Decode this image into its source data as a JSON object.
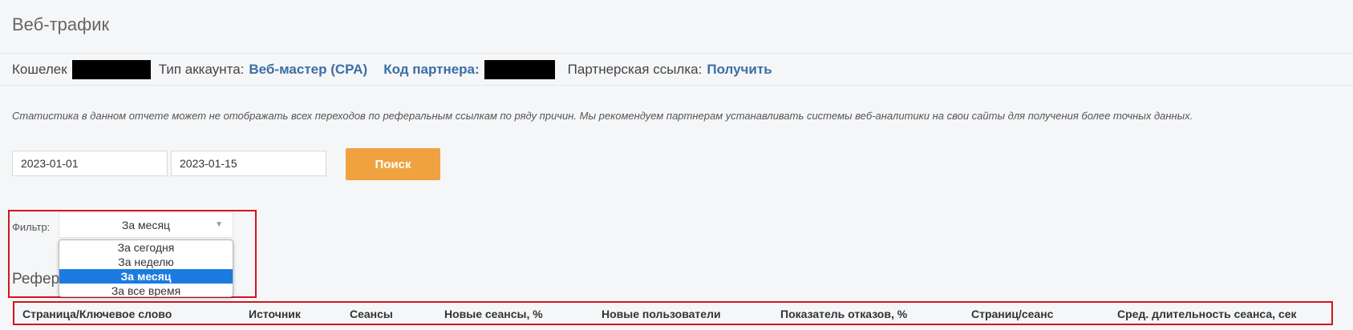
{
  "page": {
    "title": "Веб-трафик"
  },
  "account": {
    "wallet_label": "Кошелек",
    "type_label": "Тип аккаунта:",
    "type_value": "Веб-мастер (CPA)",
    "partner_code_label": "Код партнера:",
    "partner_link_label": "Партнерская ссылка:",
    "partner_link_action": "Получить"
  },
  "notice": "Статистика в данном отчете может не отображать всех переходов по реферальным ссылкам по ряду причин. Мы рекомендуем партнерам устанавливать системы веб-аналитики на свои сайты для получения более точных данных.",
  "dates": {
    "from": "2023-01-01",
    "to": "2023-01-15"
  },
  "search_button": "Поиск",
  "filter": {
    "label": "Фильтр:",
    "selected": "За месяц",
    "arrow": "▼",
    "options": [
      "За сегодня",
      "За неделю",
      "За месяц",
      "За все время"
    ],
    "selected_index": 2
  },
  "section_title": "Рефер",
  "table": {
    "columns": [
      "Страница/Ключевое слово",
      "Источник",
      "Сеансы",
      "Новые сеансы, %",
      "Новые пользователи",
      "Показатель отказов, %",
      "Страниц/сеанс",
      "Сред. длительность сеанса, сек"
    ]
  },
  "colors": {
    "accent": "#f0a23f",
    "link": "#3a6fa3",
    "highlight_border": "#d0151f",
    "selected_option": "#1c7be0"
  }
}
